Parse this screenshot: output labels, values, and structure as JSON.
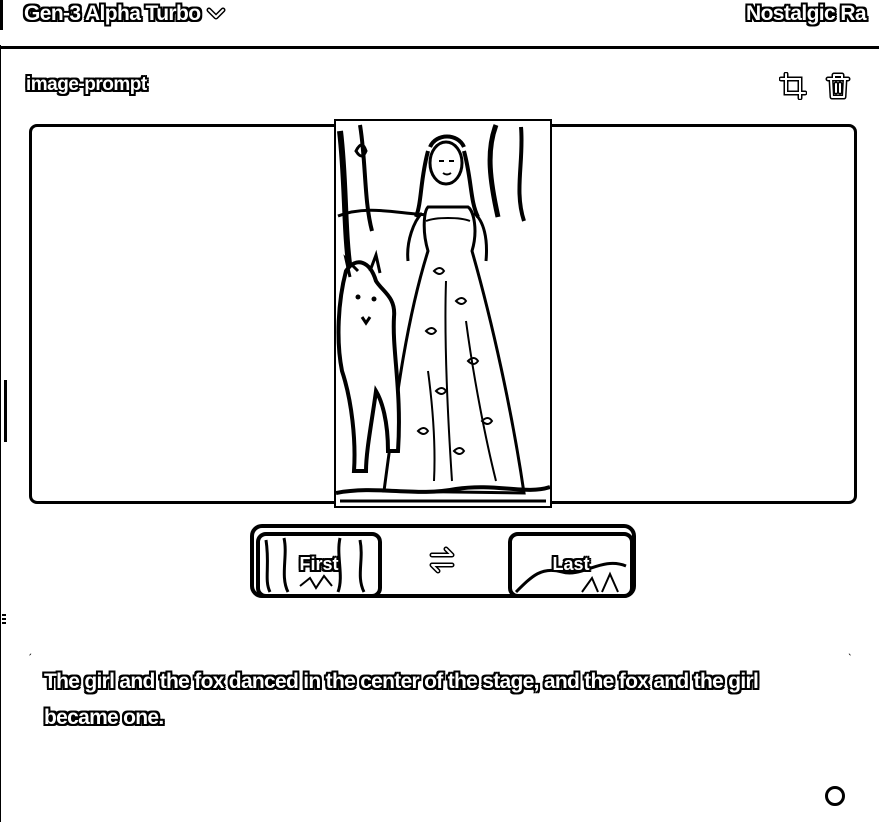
{
  "header": {
    "model_name": "Gen-3 Alpha Turbo",
    "preset_name": "Nostalgic Ra"
  },
  "image_prompt": {
    "label": "image-prompt"
  },
  "frames": {
    "first_label": "First",
    "last_label": "Last"
  },
  "prompt": {
    "text": "The girl and the fox danced in the center of the stage, and the fox and the girl became one."
  },
  "icons": {
    "model_dropdown": "chevron-down-icon",
    "crop": "crop-icon",
    "delete": "trash-icon",
    "swap": "swap-arrows-icon",
    "status": "circle-icon"
  }
}
